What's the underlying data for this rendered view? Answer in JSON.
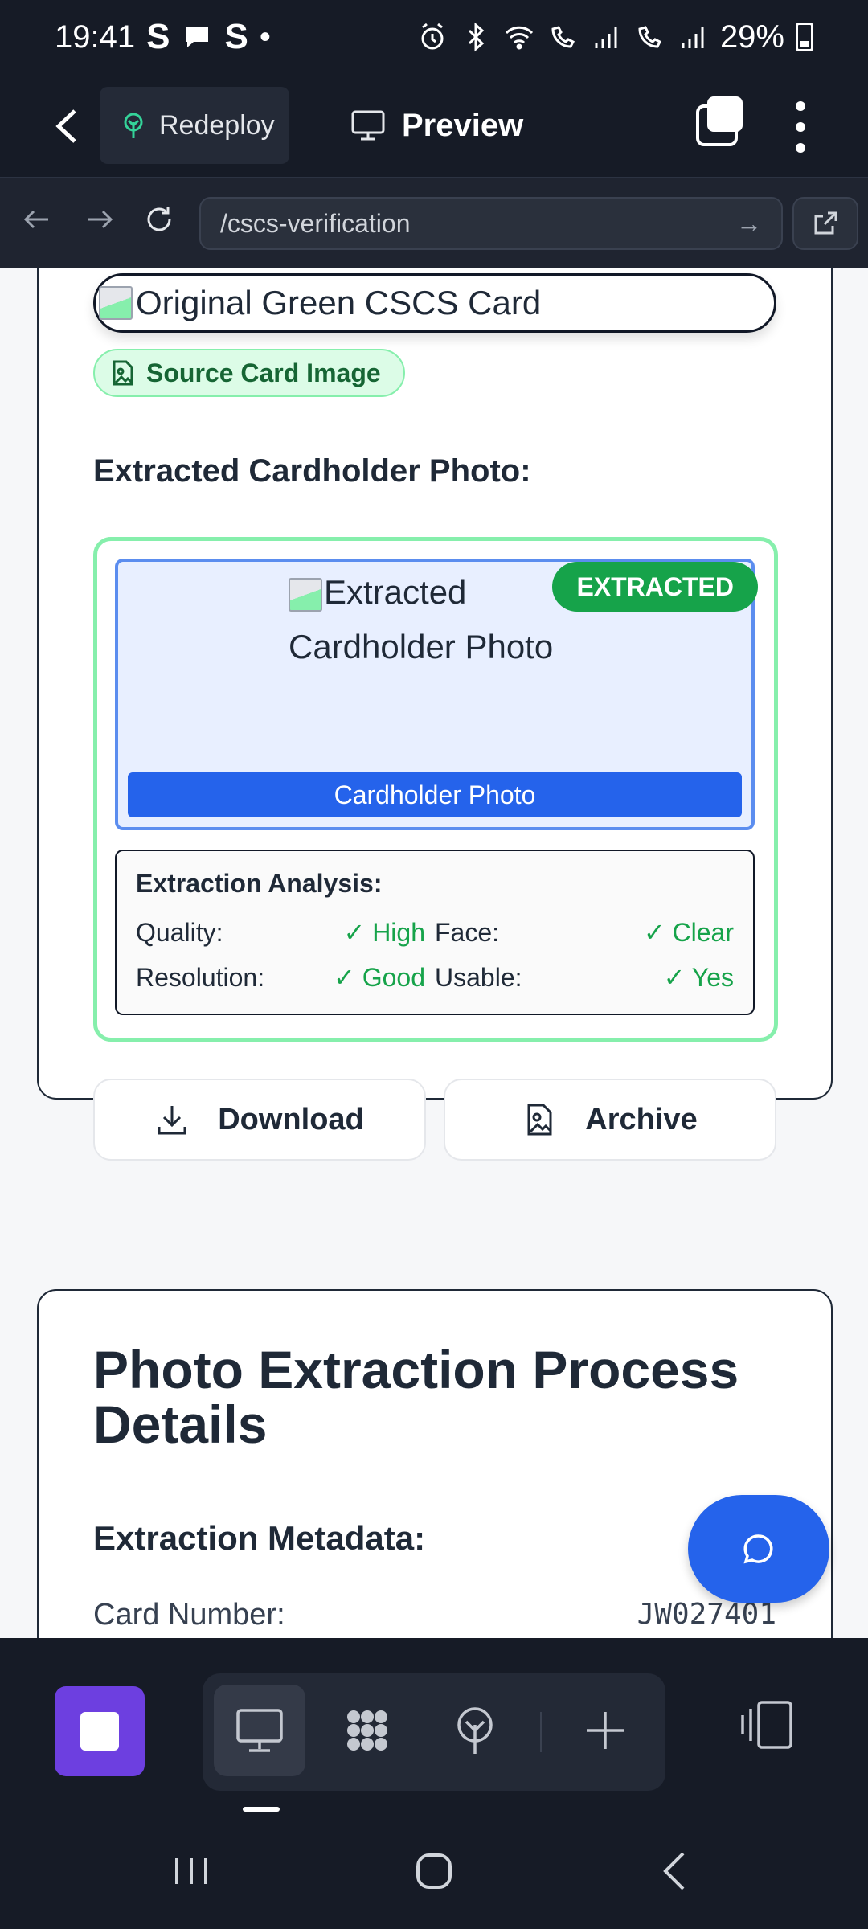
{
  "status_bar": {
    "time": "19:41",
    "left_icons": [
      "S",
      "chat-bubble",
      "S",
      "•"
    ],
    "battery": "29%"
  },
  "header": {
    "redeploy_label": "Redeploy",
    "preview_label": "Preview"
  },
  "browser": {
    "url": "/cscs-verification",
    "go_glyph": "→"
  },
  "source_card": {
    "image_alt": "Original Green CSCS Card",
    "badge_label": "Source Card Image"
  },
  "extracted": {
    "heading": "Extracted Cardholder Photo:",
    "image_alt": "Extracted Cardholder Photo",
    "badge": "EXTRACTED",
    "caption": "Cardholder Photo"
  },
  "analysis": {
    "title": "Extraction Analysis:",
    "rows": [
      [
        {
          "label": "Quality:",
          "value": "✓ High"
        },
        {
          "label": "Face:",
          "value": "✓ Clear"
        }
      ],
      [
        {
          "label": "Resolution:",
          "value": "✓ Good"
        },
        {
          "label": "Usable:",
          "value": "✓ Yes"
        }
      ]
    ]
  },
  "actions": {
    "download_label": "Download",
    "archive_label": "Archive"
  },
  "process": {
    "title": "Photo Extraction Process Details",
    "metadata_heading": "Extraction Metadata:",
    "card_number_label": "Card Number:",
    "card_number_value": "JW027401"
  },
  "colors": {
    "accent_blue": "#2563eb",
    "success_green": "#16a34a",
    "app_purple": "#6d3fe0",
    "chrome_dark": "#161b26"
  }
}
